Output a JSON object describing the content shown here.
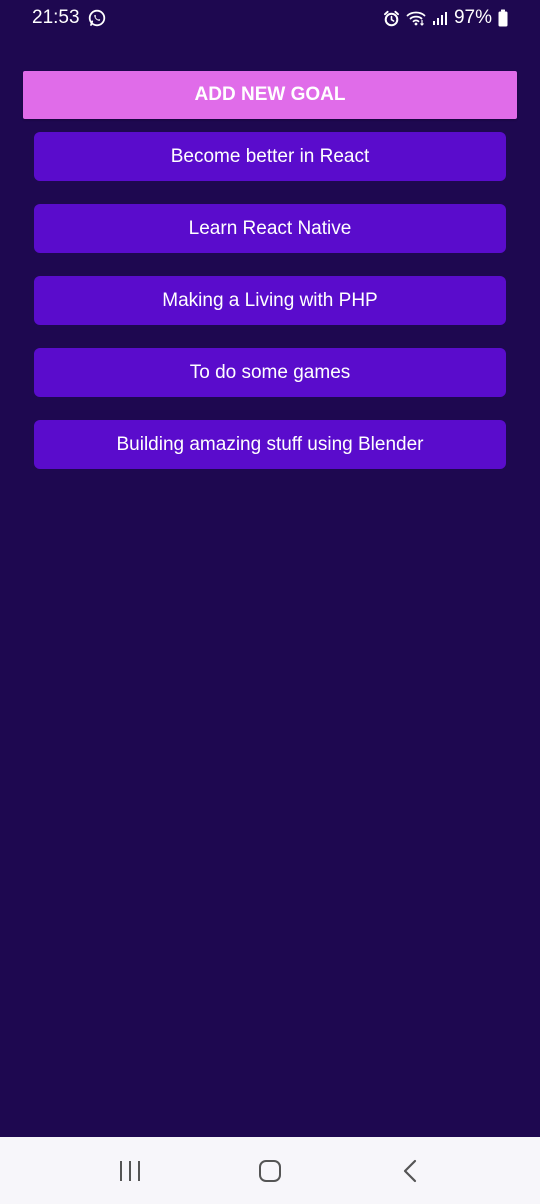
{
  "status_bar": {
    "time": "21:53",
    "battery": "97%"
  },
  "add_button": {
    "label": "ADD NEW GOAL"
  },
  "goals": [
    "Become better in React",
    "Learn React Native",
    "Making a Living with PHP",
    "To do some games",
    "Building amazing stuff using Blender"
  ],
  "colors": {
    "background": "#1e0850",
    "add_button": "#e06ce9",
    "goal_item": "#5a0ccc",
    "nav_bar": "#f7f6fa"
  },
  "icons": {
    "status_left": [
      "whatsapp-icon"
    ],
    "status_right": [
      "alarm-icon",
      "wifi-icon",
      "signal-icon",
      "battery-icon"
    ],
    "nav": [
      "recent-apps-icon",
      "home-icon",
      "back-icon"
    ]
  }
}
